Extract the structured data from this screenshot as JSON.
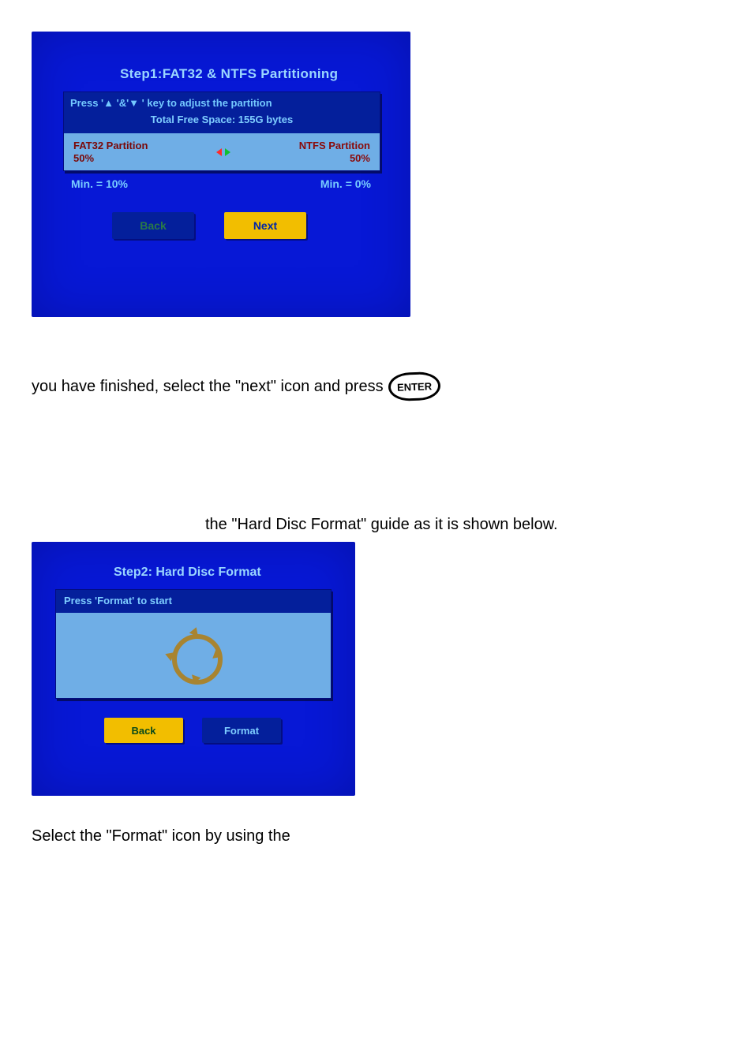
{
  "screen1": {
    "title": "Step1:FAT32 & NTFS Partitioning",
    "instruction": "Press '▲  '&'▼  ' key to adjust the partition",
    "total": "Total Free Space: 155G bytes",
    "fat_label": "FAT32 Partition",
    "fat_pct": "50%",
    "ntfs_label": "NTFS Partition",
    "ntfs_pct": "50%",
    "min_left": "Min. = 10%",
    "min_right": "Min. = 0%",
    "back": "Back",
    "next": "Next"
  },
  "text1": "you have finished, select the \"next\" icon and press",
  "enter": "ENTER",
  "text2": "the \"Hard Disc Format\" guide as it is shown below.",
  "screen2": {
    "title": "Step2: Hard Disc Format",
    "instruction": "Press 'Format' to start",
    "back": "Back",
    "format": "Format"
  },
  "text3": "Select the \"Format\" icon by using the"
}
